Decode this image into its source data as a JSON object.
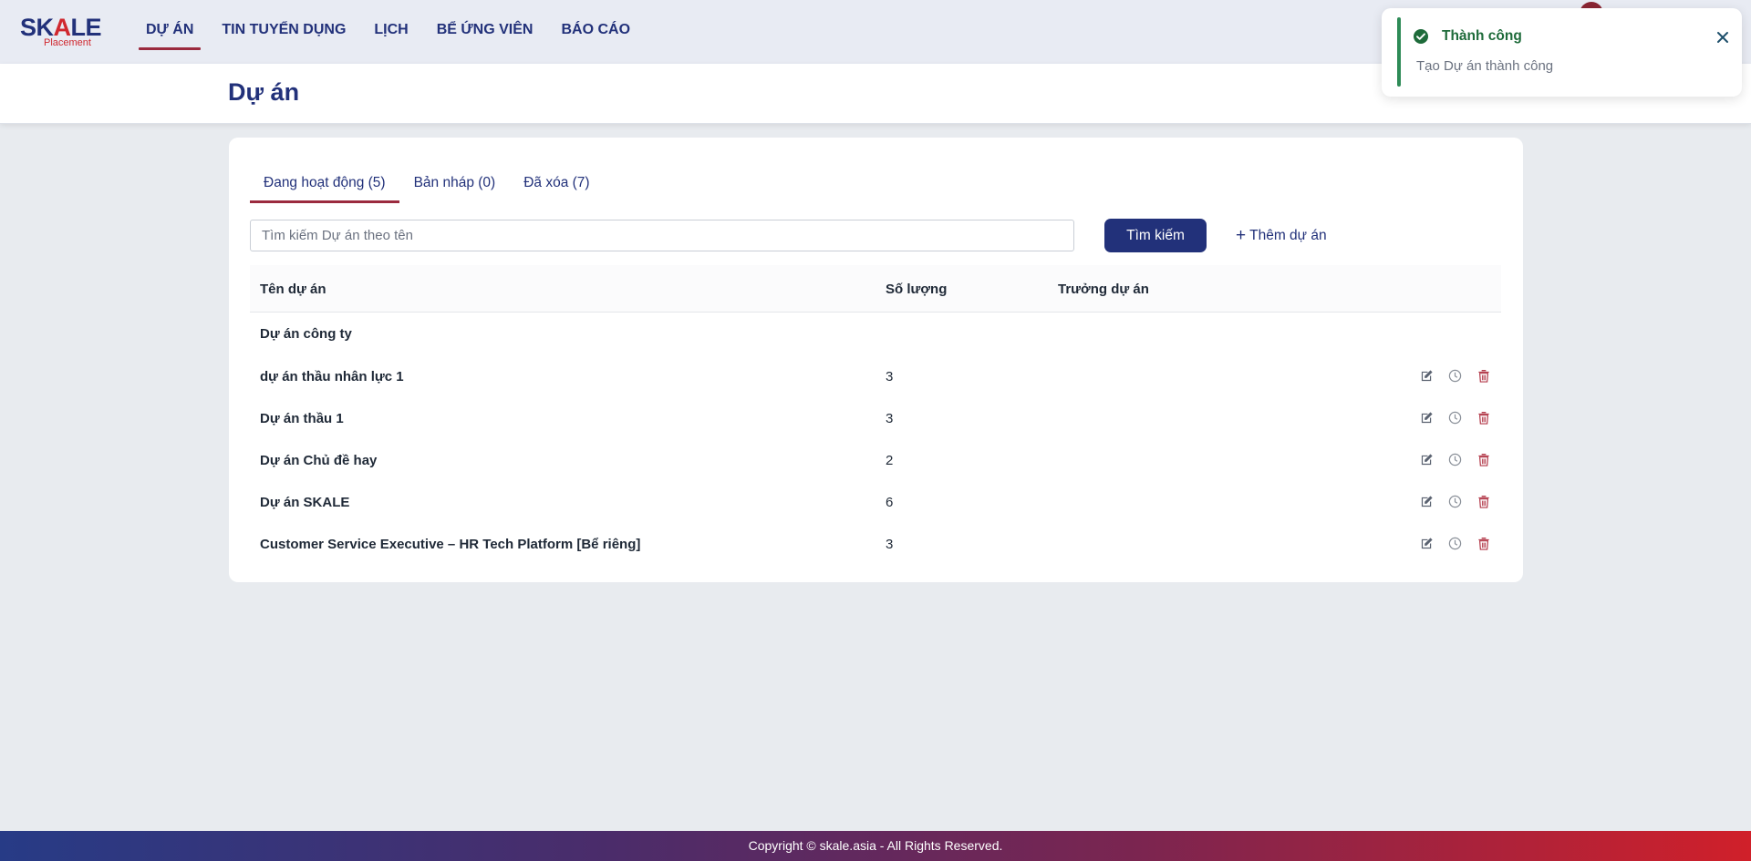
{
  "brand": {
    "logo_main_a": "SK",
    "logo_main_b": "A",
    "logo_main_c": "LE",
    "logo_sub": "Placement"
  },
  "nav": {
    "items": [
      {
        "label": "DỰ ÁN",
        "active": true
      },
      {
        "label": "TIN TUYỂN DỤNG",
        "active": false
      },
      {
        "label": "LỊCH",
        "active": false
      },
      {
        "label": "BỂ ỨNG VIÊN",
        "active": false
      },
      {
        "label": "BÁO CÁO",
        "active": false
      }
    ]
  },
  "page": {
    "title": "Dự án"
  },
  "tabs": [
    {
      "label": "Đang hoạt động (5)",
      "active": true
    },
    {
      "label": "Bản nháp (0)",
      "active": false
    },
    {
      "label": "Đã xóa (7)",
      "active": false
    }
  ],
  "search": {
    "placeholder": "Tìm kiếm Dự án theo tên",
    "value": "",
    "button_label": "Tìm kiếm"
  },
  "add_button": {
    "label": "Thêm dự án",
    "icon": "plus-icon"
  },
  "table": {
    "columns": [
      "Tên dự án",
      "Số lượng",
      "Trưởng dự án"
    ],
    "group_label": "Dự án công ty",
    "rows": [
      {
        "name": "dự án thầu nhân lực 1",
        "quantity": "3",
        "lead": ""
      },
      {
        "name": "Dự án thầu 1",
        "quantity": "3",
        "lead": ""
      },
      {
        "name": "Dự án Chủ đề hay",
        "quantity": "2",
        "lead": ""
      },
      {
        "name": "Dự án SKALE",
        "quantity": "6",
        "lead": ""
      },
      {
        "name": "Customer Service Executive – HR Tech Platform [Bể riêng]",
        "quantity": "3",
        "lead": ""
      }
    ],
    "row_actions": [
      "edit-icon",
      "history-icon",
      "delete-icon"
    ]
  },
  "toast": {
    "title": "Thành công",
    "message": "Tạo Dự án thành công",
    "status_color": "#2e8b57"
  },
  "footer": {
    "text": "Copyright © skale.asia - All Rights Reserved."
  },
  "colors": {
    "primary": "#22317a",
    "accent": "#9b2a3e",
    "danger": "#b33a4a",
    "success": "#2e8b57"
  }
}
